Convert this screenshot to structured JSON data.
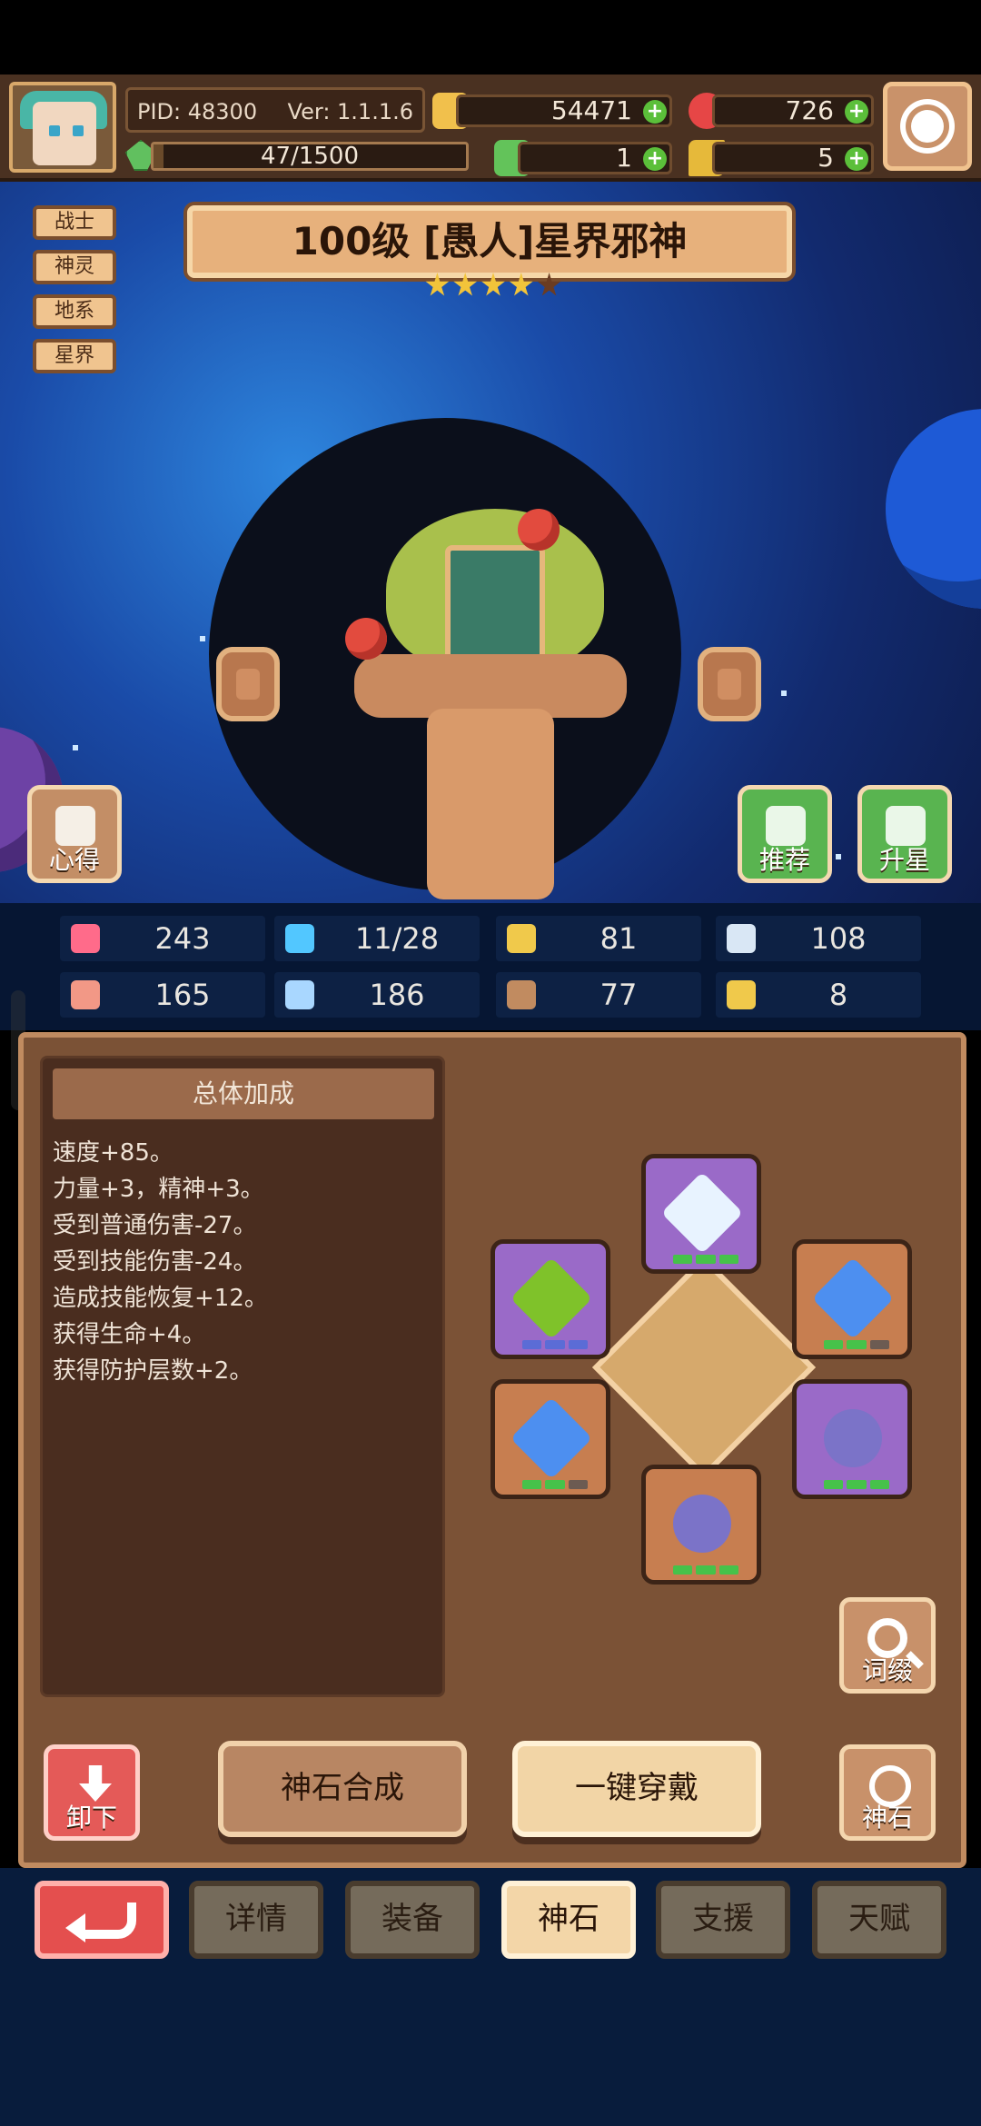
{
  "header": {
    "pid": "PID: 48300",
    "ver": "Ver: 1.1.1.6",
    "exp": "47/1500",
    "exp_fraction": 0.031,
    "resources": {
      "gold": "54471",
      "ruby": "726",
      "clover": "1",
      "key": "5"
    }
  },
  "tags": [
    "战士",
    "神灵",
    "地系",
    "星界"
  ],
  "hero": {
    "banner": "100级 [愚人]星界邪神",
    "stars_filled": 4,
    "stars_total": 5
  },
  "side_buttons": {
    "notes": "心得",
    "recommend": "推荐",
    "upgrade": "升星"
  },
  "stats": [
    {
      "icon": "heart-icon",
      "value": "243"
    },
    {
      "icon": "drop-icon",
      "value": "11/28"
    },
    {
      "icon": "shield-icon",
      "value": "81"
    },
    {
      "icon": "wing-icon",
      "value": "108"
    },
    {
      "icon": "fist-icon",
      "value": "165"
    },
    {
      "icon": "book-icon",
      "value": "186"
    },
    {
      "icon": "potion-icon",
      "value": "77"
    },
    {
      "icon": "horseshoe-icon",
      "value": "8"
    }
  ],
  "bonus": {
    "title": "总体加成",
    "lines": [
      "速度+85。",
      "力量+3，精神+3。",
      "受到普通伤害-27。",
      "受到技能伤害-24。",
      "造成技能恢复+12。",
      "获得生命+4。",
      "获得防护层数+2。"
    ]
  },
  "gem_buttons": {
    "affix": "词缀",
    "unequip": "卸下",
    "synthesize": "神石合成",
    "equip_all": "一键穿戴",
    "godstone": "神石"
  },
  "tabs": [
    "详情",
    "装备",
    "神石",
    "支援",
    "天赋"
  ],
  "active_tab": "神石"
}
